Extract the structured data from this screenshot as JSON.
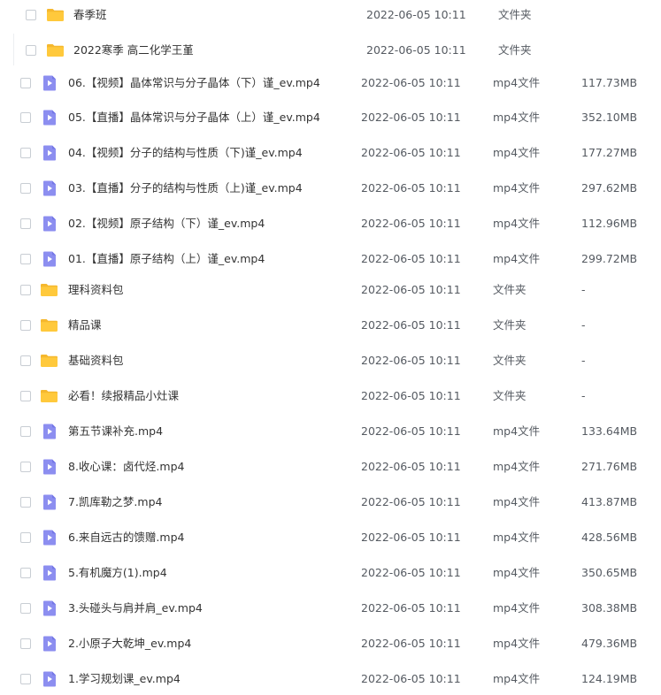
{
  "colors": {
    "folder": "#FFC93C",
    "folder_dark": "#F5B82E",
    "video": "#8C8EF0",
    "video_dark": "#7476E6"
  },
  "files": [
    {
      "name": "春季班",
      "date": "2022-06-05 10:11",
      "type": "文件夹",
      "size": "",
      "icon": "folder-icon"
    },
    {
      "name": "2022寒季  高二化学王堇",
      "date": "2022-06-05 10:11",
      "type": "文件夹",
      "size": "",
      "icon": "folder-icon"
    },
    {
      "name": "06.【视频】晶体常识与分子晶体（下）谨_ev.mp4",
      "date": "2022-06-05 10:11",
      "type": "mp4文件",
      "size": "117.73MB",
      "icon": "video-file-icon"
    },
    {
      "name": "05.【直播】晶体常识与分子晶体（上）谨_ev.mp4",
      "date": "2022-06-05 10:11",
      "type": "mp4文件",
      "size": "352.10MB",
      "icon": "video-file-icon"
    },
    {
      "name": "04.【视频】分子的结构与性质（下)谨_ev.mp4",
      "date": "2022-06-05 10:11",
      "type": "mp4文件",
      "size": "177.27MB",
      "icon": "video-file-icon"
    },
    {
      "name": "03.【直播】分子的结构与性质（上)谨_ev.mp4",
      "date": "2022-06-05 10:11",
      "type": "mp4文件",
      "size": "297.62MB",
      "icon": "video-file-icon"
    },
    {
      "name": "02.【视频】原子结构（下）谨_ev.mp4",
      "date": "2022-06-05 10:11",
      "type": "mp4文件",
      "size": "112.96MB",
      "icon": "video-file-icon"
    },
    {
      "name": "01.【直播】原子结构（上）谨_ev.mp4",
      "date": "2022-06-05 10:11",
      "type": "mp4文件",
      "size": "299.72MB",
      "icon": "video-file-icon"
    },
    {
      "name": "理科资料包",
      "date": "2022-06-05 10:11",
      "type": "文件夹",
      "size": "-",
      "icon": "folder-icon"
    },
    {
      "name": "精品课",
      "date": "2022-06-05 10:11",
      "type": "文件夹",
      "size": "-",
      "icon": "folder-icon"
    },
    {
      "name": "基础资料包",
      "date": "2022-06-05 10:11",
      "type": "文件夹",
      "size": "-",
      "icon": "folder-icon"
    },
    {
      "name": "必看！续报精品小灶课",
      "date": "2022-06-05 10:11",
      "type": "文件夹",
      "size": "-",
      "icon": "folder-icon"
    },
    {
      "name": "第五节课补充.mp4",
      "date": "2022-06-05 10:11",
      "type": "mp4文件",
      "size": "133.64MB",
      "icon": "video-file-icon"
    },
    {
      "name": "8.收心课：卤代烃.mp4",
      "date": "2022-06-05 10:11",
      "type": "mp4文件",
      "size": "271.76MB",
      "icon": "video-file-icon"
    },
    {
      "name": "7.凯库勒之梦.mp4",
      "date": "2022-06-05 10:11",
      "type": "mp4文件",
      "size": "413.87MB",
      "icon": "video-file-icon"
    },
    {
      "name": "6.来自远古的馈赠.mp4",
      "date": "2022-06-05 10:11",
      "type": "mp4文件",
      "size": "428.56MB",
      "icon": "video-file-icon"
    },
    {
      "name": "5.有机魔方(1).mp4",
      "date": "2022-06-05 10:11",
      "type": "mp4文件",
      "size": "350.65MB",
      "icon": "video-file-icon"
    },
    {
      "name": "3.头碰头与肩并肩_ev.mp4",
      "date": "2022-06-05 10:11",
      "type": "mp4文件",
      "size": "308.38MB",
      "icon": "video-file-icon"
    },
    {
      "name": "2.小原子大乾坤_ev.mp4",
      "date": "2022-06-05 10:11",
      "type": "mp4文件",
      "size": "479.36MB",
      "icon": "video-file-icon"
    },
    {
      "name": "1.学习规划课_ev.mp4",
      "date": "2022-06-05 10:11",
      "type": "mp4文件",
      "size": "124.19MB",
      "icon": "video-file-icon"
    }
  ]
}
